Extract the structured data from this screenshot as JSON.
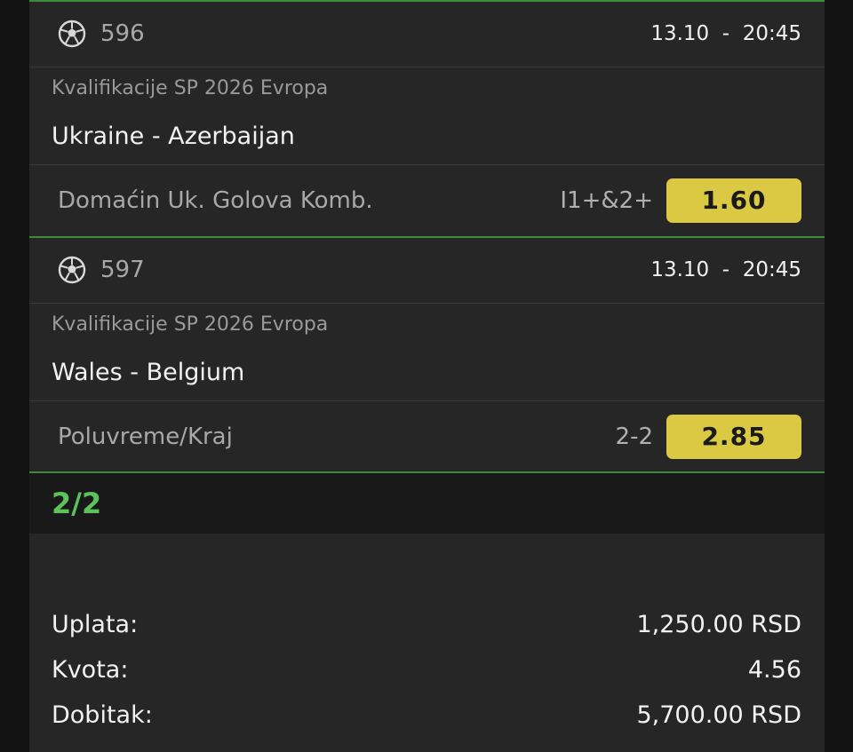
{
  "matches": [
    {
      "number": "596",
      "time": "13.10  -  20:45",
      "league": "Kvalifikacije SP 2026 Evropa",
      "teams": "Ukraine - Azerbaijan",
      "market": "Domaćin Uk. Golova Komb.",
      "pick": "I1+&2+",
      "odds": "1.60",
      "icon": "soccer-ball-icon"
    },
    {
      "number": "597",
      "time": "13.10  -  20:45",
      "league": "Kvalifikacije SP 2026 Evropa",
      "teams": "Wales - Belgium",
      "market": "Poluvreme/Kraj",
      "pick": "2-2",
      "odds": "2.85",
      "icon": "soccer-ball-icon"
    }
  ],
  "ticket": {
    "count": "2/2"
  },
  "summary": {
    "stake_label": "Uplata:",
    "stake_value": "1,250.00 RSD",
    "odds_label": "Kvota:",
    "odds_value": "4.56",
    "payout_label": "Dobitak:",
    "payout_value": "5,700.00 RSD"
  },
  "colors": {
    "odds_button": "#dcc943",
    "count_green": "#5cc35a",
    "divider_green": "#3c8a3a",
    "panel_bg": "#262626"
  }
}
